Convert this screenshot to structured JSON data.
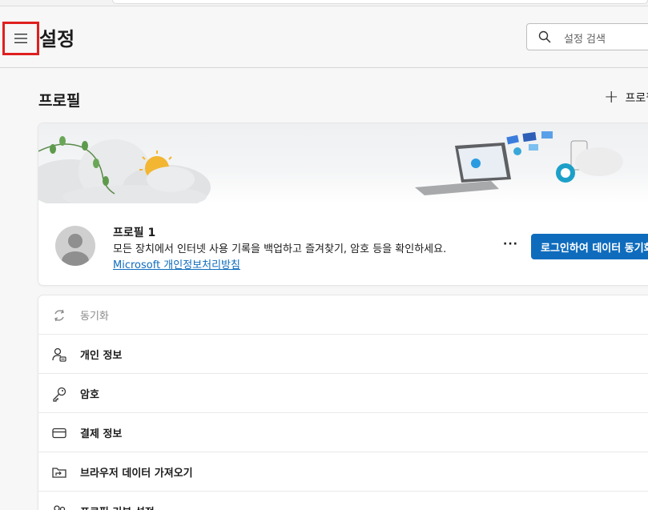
{
  "header": {
    "title": "설정",
    "menu_icon": "hamburger-menu-icon",
    "search": {
      "placeholder": "설정 검색",
      "icon": "search-icon"
    }
  },
  "profiles_section": {
    "title": "프로필",
    "add_profile_label": "프로필 추가",
    "profile": {
      "name": "프로필 1",
      "description": "모든 장치에서 인터넷 사용 기록을 백업하고 즐겨찾기, 암호 등을 확인하세요. ",
      "privacy_link": "Microsoft 개인정보처리방침",
      "more_label": "···",
      "signin_button": "로그인하여 데이터 동기화"
    }
  },
  "menu_items": [
    {
      "label": "동기화",
      "icon": "sync-icon",
      "disabled": true
    },
    {
      "label": "개인 정보",
      "icon": "personal-info-icon",
      "disabled": false
    },
    {
      "label": "암호",
      "icon": "key-icon",
      "disabled": false
    },
    {
      "label": "결제 정보",
      "icon": "credit-card-icon",
      "disabled": false
    },
    {
      "label": "브라우저 데이터 가져오기",
      "icon": "import-folder-icon",
      "disabled": false
    },
    {
      "label": "프로필 기본 설정",
      "icon": "profile-preferences-icon",
      "disabled": false
    }
  ],
  "colors": {
    "accent": "#0f6cbd",
    "highlight_border": "#e01f1f",
    "page_bg": "#f7f7f7"
  }
}
